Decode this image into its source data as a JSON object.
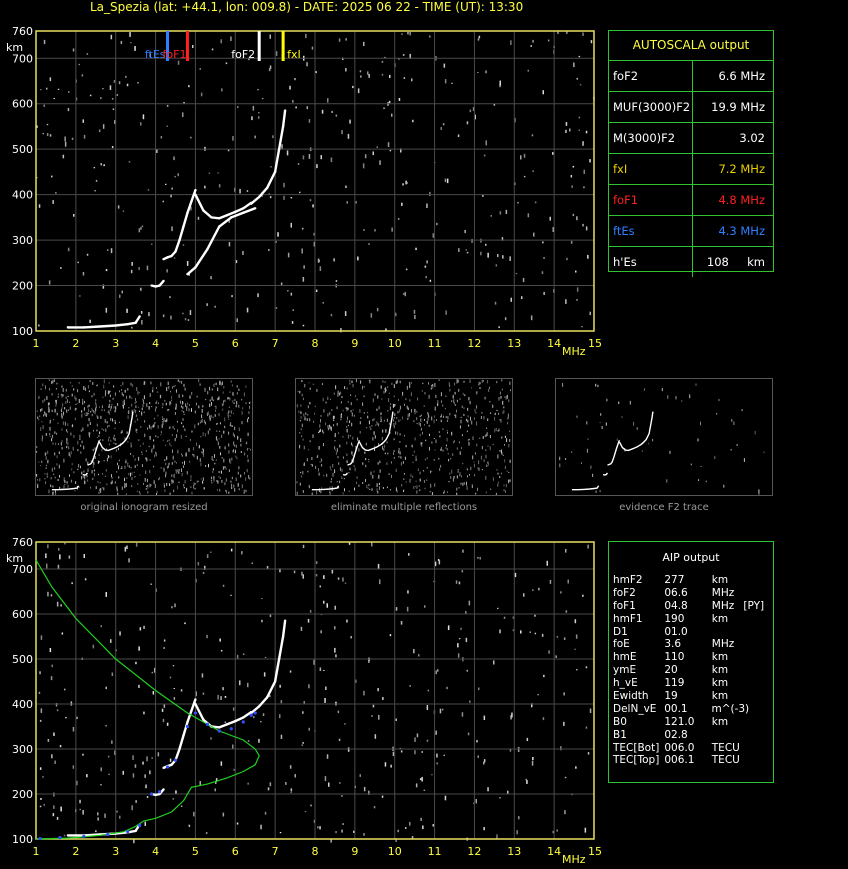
{
  "header": {
    "title": "La_Spezia (lat: +44.1, lon: 009.8) - DATE: 2025 06 22 - TIME (UT): 13:30"
  },
  "chart_data": [
    {
      "type": "scatter",
      "xlabel": "MHz",
      "ylabel": "km",
      "xlim": [
        1,
        15
      ],
      "ylim": [
        100,
        760
      ],
      "xticks": [
        "1",
        "2",
        "3",
        "4",
        "5",
        "6",
        "7",
        "8",
        "9",
        "10",
        "11",
        "12",
        "13",
        "14",
        "15"
      ],
      "yticks": [
        "100",
        "200",
        "300",
        "400",
        "500",
        "600",
        "700",
        "760"
      ],
      "grid": true,
      "markers": [
        {
          "label": "ftEs",
          "x": 4.3,
          "color": "#2f7fff"
        },
        {
          "label": "foF1",
          "x": 4.8,
          "color": "#ff2020"
        },
        {
          "label": "foF2",
          "x": 6.6,
          "color": "#ffffff"
        },
        {
          "label": "fxI",
          "x": 7.2,
          "color": "#ffff00"
        }
      ],
      "series": [
        {
          "x": [
            1.8,
            2.2,
            2.6,
            3.0,
            3.3,
            3.5,
            3.6
          ],
          "y": [
            108,
            108,
            110,
            112,
            115,
            118,
            132
          ]
        },
        {
          "x": [
            3.9,
            4.0,
            4.1,
            4.2
          ],
          "y": [
            200,
            198,
            200,
            210
          ]
        },
        {
          "x": [
            4.2,
            4.3,
            4.4,
            4.5,
            4.6,
            4.7,
            4.8,
            4.9,
            5.0
          ],
          "y": [
            258,
            262,
            265,
            275,
            300,
            330,
            360,
            385,
            410
          ]
        },
        {
          "x": [
            5.0,
            5.2,
            5.4,
            5.6,
            5.8,
            6.0,
            6.2,
            6.4
          ],
          "y": [
            400,
            365,
            350,
            348,
            355,
            362,
            370,
            382
          ]
        },
        {
          "x": [
            6.4,
            6.6,
            6.8,
            7.0,
            7.1,
            7.2,
            7.25
          ],
          "y": [
            380,
            395,
            415,
            450,
            500,
            550,
            585
          ]
        },
        {
          "x": [
            4.8,
            5.0,
            5.3,
            5.6,
            5.9,
            6.2,
            6.5
          ],
          "y": [
            225,
            240,
            280,
            330,
            350,
            360,
            370
          ]
        }
      ]
    },
    {
      "type": "scatter",
      "xlabel": "MHz",
      "ylabel": "km",
      "xlim": [
        1,
        15
      ],
      "ylim": [
        100,
        760
      ],
      "xticks": [
        "1",
        "2",
        "3",
        "4",
        "5",
        "6",
        "7",
        "8",
        "9",
        "10",
        "11",
        "12",
        "13",
        "14",
        "15"
      ],
      "yticks": [
        "100",
        "200",
        "300",
        "400",
        "500",
        "600",
        "700",
        "760"
      ],
      "grid": true,
      "series": [
        {
          "x": [
            1.8,
            2.2,
            2.6,
            3.0,
            3.3,
            3.5,
            3.6
          ],
          "y": [
            108,
            108,
            110,
            112,
            115,
            118,
            132
          ]
        },
        {
          "x": [
            3.9,
            4.0,
            4.1,
            4.2
          ],
          "y": [
            200,
            198,
            200,
            210
          ]
        },
        {
          "x": [
            4.2,
            4.3,
            4.4,
            4.5,
            4.6,
            4.7,
            4.8,
            4.9,
            5.0
          ],
          "y": [
            258,
            262,
            265,
            275,
            300,
            330,
            360,
            385,
            410
          ]
        },
        {
          "x": [
            5.0,
            5.2,
            5.4,
            5.6,
            5.8,
            6.0,
            6.2,
            6.4
          ],
          "y": [
            400,
            365,
            350,
            348,
            355,
            362,
            370,
            382
          ]
        },
        {
          "x": [
            6.4,
            6.6,
            6.8,
            7.0,
            7.1,
            7.2,
            7.25
          ],
          "y": [
            380,
            395,
            415,
            450,
            500,
            550,
            585
          ]
        },
        {
          "x": [
            1.0,
            1.8,
            2.6,
            3.2,
            3.5,
            3.7,
            4.0,
            4.4,
            4.7,
            4.9,
            5.3,
            5.8,
            6.2,
            6.5,
            6.6,
            6.5,
            6.2,
            5.6,
            4.8,
            4.0,
            3.0,
            2.0,
            1.4,
            1.0
          ],
          "y": [
            100,
            102,
            108,
            116,
            128,
            140,
            146,
            160,
            185,
            215,
            222,
            236,
            250,
            265,
            285,
            300,
            320,
            340,
            380,
            430,
            500,
            590,
            660,
            720
          ],
          "color": "#20d020"
        },
        {
          "x": [
            1.1,
            1.6,
            2.2,
            2.8,
            3.3,
            3.6,
            3.9,
            4.1,
            4.3,
            4.5,
            4.8,
            5.0,
            5.3,
            5.6,
            5.9,
            6.2,
            6.4,
            6.5
          ],
          "y": [
            101,
            103,
            106,
            110,
            116,
            130,
            200,
            205,
            260,
            275,
            350,
            380,
            355,
            340,
            345,
            360,
            375,
            380
          ],
          "color": "#3050ff"
        }
      ]
    }
  ],
  "autoscala": {
    "title": "AUTOSCALA output",
    "rows": [
      {
        "key": "foF2",
        "value": "6.6 MHz",
        "kcolor": "#ffffff",
        "vcolor": "#ffffff"
      },
      {
        "key": "MUF(3000)F2",
        "value": "19.9 MHz",
        "kcolor": "#ffffff",
        "vcolor": "#ffffff"
      },
      {
        "key": "M(3000)F2",
        "value": "3.02",
        "kcolor": "#ffffff",
        "vcolor": "#ffffff"
      },
      {
        "key": "fxI",
        "value": "7.2 MHz",
        "kcolor": "#e8d000",
        "vcolor": "#e8d000"
      },
      {
        "key": "foF1",
        "value": "4.8 MHz",
        "kcolor": "#ff2020",
        "vcolor": "#ff2020"
      },
      {
        "key": "ftEs",
        "value": "4.3 MHz",
        "kcolor": "#3080ff",
        "vcolor": "#3080ff"
      },
      {
        "key": "h'Es",
        "value": "108     km",
        "kcolor": "#ffffff",
        "vcolor": "#ffffff"
      }
    ]
  },
  "aip": {
    "title": "AIP output",
    "rows": [
      [
        "hmF2",
        "277",
        "km",
        ""
      ],
      [
        "foF2",
        "06.6",
        "MHz",
        ""
      ],
      [
        "foF1",
        "04.8",
        "MHz",
        "[PY]"
      ],
      [
        "hmF1",
        "190",
        "km",
        ""
      ],
      [
        "D1",
        "01.0",
        "",
        ""
      ],
      [
        "foE",
        "3.6",
        "MHz",
        ""
      ],
      [
        "hmE",
        "110",
        "km",
        ""
      ],
      [
        "ymE",
        "20",
        "km",
        ""
      ],
      [
        "h_vE",
        "119",
        "km",
        ""
      ],
      [
        "Ewidth",
        "19",
        "km",
        ""
      ],
      [
        "DelN_vE",
        "00.1",
        "m^(-3)",
        ""
      ],
      [
        "B0",
        "121.0",
        "km",
        ""
      ],
      [
        "B1",
        "02.8",
        "",
        ""
      ],
      [
        "TEC[Bot]",
        "006.0",
        "TECU",
        ""
      ],
      [
        "TEC[Top]",
        "006.1",
        "TECU",
        ""
      ]
    ]
  },
  "thumbnails": [
    {
      "caption": "original ionogram resized"
    },
    {
      "caption": "eliminate multiple reflections"
    },
    {
      "caption": "evidence F2 trace"
    }
  ]
}
